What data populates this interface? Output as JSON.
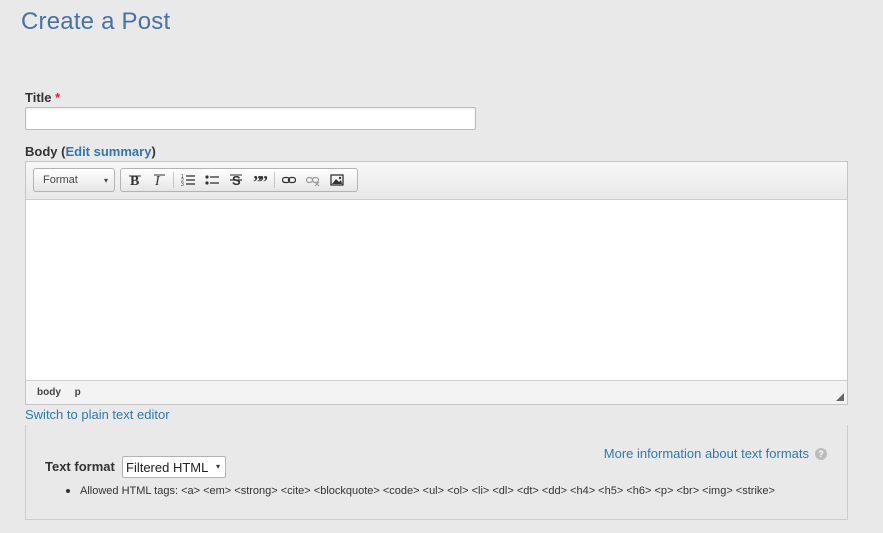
{
  "page": {
    "title": "Create a Post"
  },
  "title_field": {
    "label": "Title",
    "required_mark": "*",
    "value": ""
  },
  "body_field": {
    "label_prefix": "Body (",
    "edit_summary": "Edit summary",
    "label_suffix": ")"
  },
  "toolbar": {
    "format_label": "Format",
    "buttons": [
      {
        "name": "bold",
        "glyph": "B"
      },
      {
        "name": "italic",
        "glyph": "I"
      },
      {
        "name": "numbered-list",
        "glyph": "≡"
      },
      {
        "name": "bulleted-list",
        "glyph": "☰"
      },
      {
        "name": "strikethrough",
        "glyph": "S"
      },
      {
        "name": "blockquote",
        "glyph": "”"
      },
      {
        "name": "link",
        "glyph": "⊂⊃"
      },
      {
        "name": "unlink",
        "glyph": "⊘"
      },
      {
        "name": "image",
        "glyph": "▣"
      }
    ]
  },
  "status_path": [
    "body",
    "p"
  ],
  "switch_link": "Switch to plain text editor",
  "text_format": {
    "more_info": "More information about text formats",
    "help_glyph": "?",
    "label": "Text format",
    "selected": "Filtered HTML",
    "allowed_tags": "Allowed HTML tags: <a> <em> <strong> <cite> <blockquote> <code> <ul> <ol> <li> <dl> <dt> <dd> <h4> <h5> <h6> <p> <br> <img> <strike>"
  },
  "colors": {
    "title": "#4a70a8",
    "link": "#2f77b6",
    "required": "#dd2222",
    "background": "#e9e9e9"
  }
}
